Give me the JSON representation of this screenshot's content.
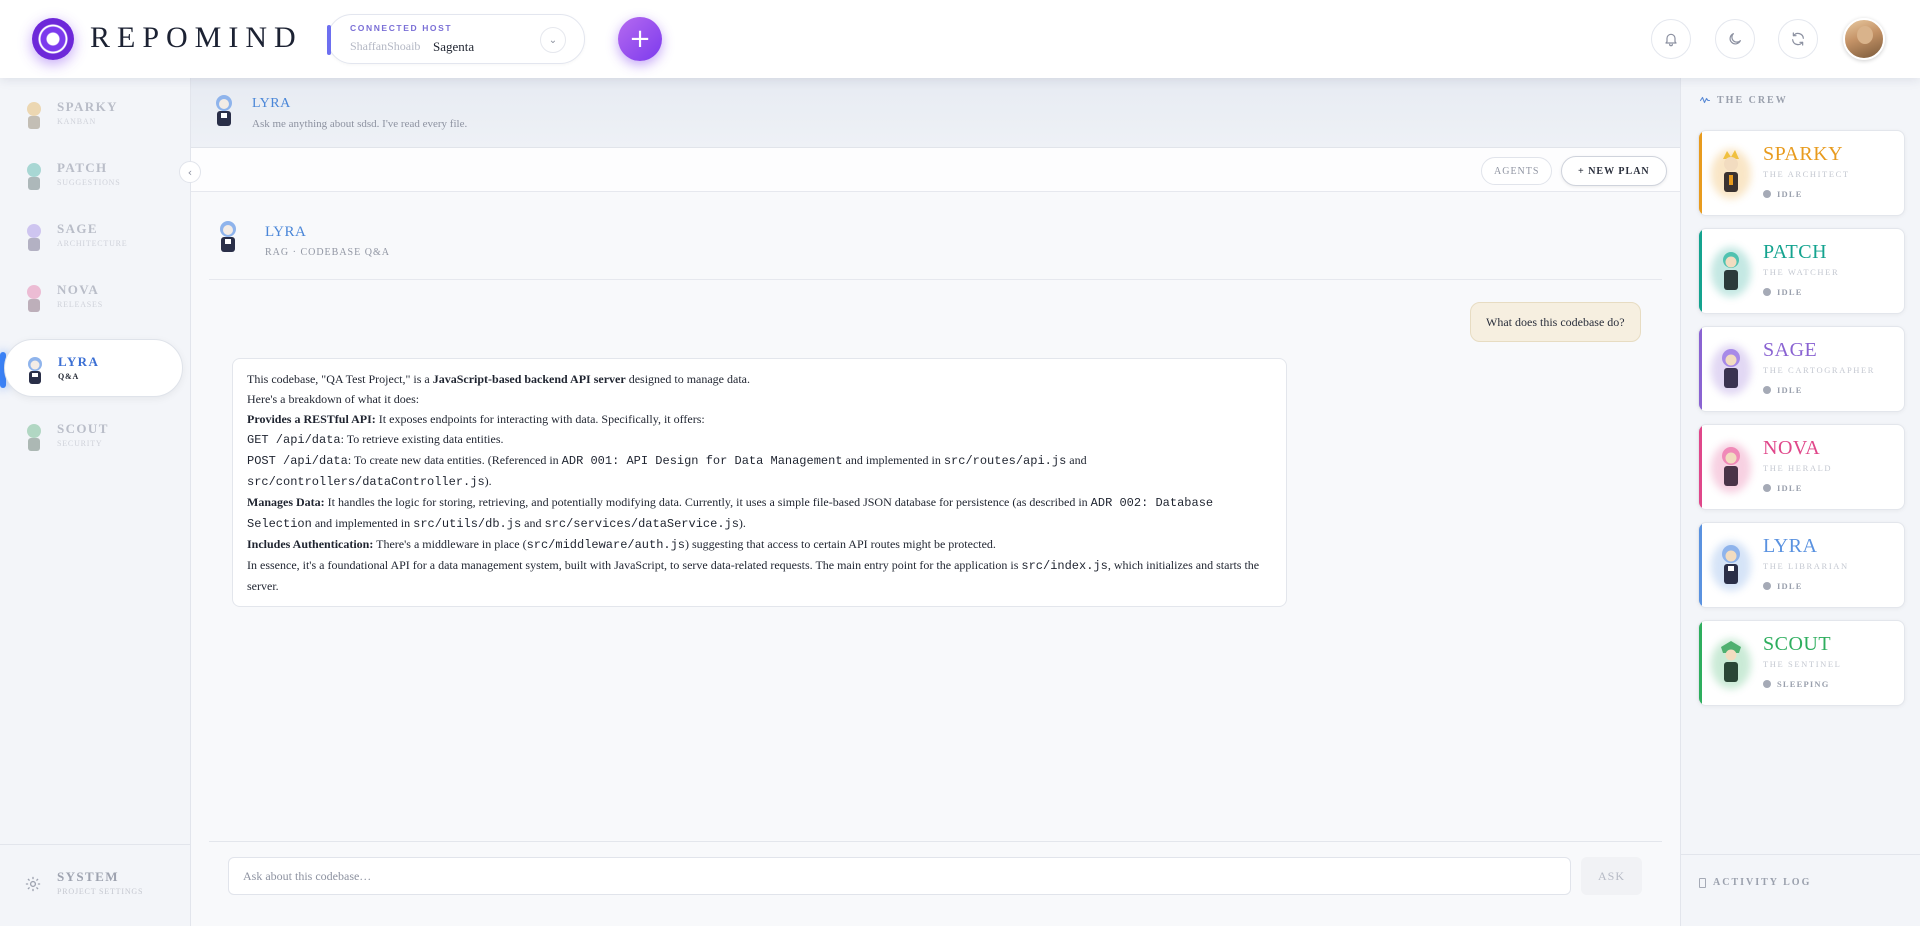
{
  "app": {
    "brand": "REPOMIND"
  },
  "header": {
    "host_label": "CONNECTED HOST",
    "host_owner": "ShaffanShoaib",
    "host_name": "Sagenta",
    "icons": [
      "bell-icon",
      "moon-icon",
      "refresh-icon"
    ]
  },
  "sidebar": {
    "items": [
      {
        "name": "SPARKY",
        "sub": "KANBAN",
        "color": "#e0a030"
      },
      {
        "name": "PATCH",
        "sub": "SUGGESTIONS",
        "color": "#20a090"
      },
      {
        "name": "SAGE",
        "sub": "ARCHITECTURE",
        "color": "#8c6ee0"
      },
      {
        "name": "NOVA",
        "sub": "RELEASES",
        "color": "#e05590"
      },
      {
        "name": "LYRA",
        "sub": "Q&A",
        "color": "#4a86d8"
      },
      {
        "name": "SCOUT",
        "sub": "SECURITY",
        "color": "#3aa060"
      }
    ],
    "system": {
      "name": "SYSTEM",
      "sub": "PROJECT SETTINGS"
    }
  },
  "main": {
    "banner": {
      "name": "LYRA",
      "desc": "Ask me anything about sdsd. I've read every file."
    },
    "toolbar": {
      "agents": "AGENTS",
      "new_plan": "+ NEW PLAN"
    },
    "chat_head": {
      "name": "LYRA",
      "sub": "RAG · CODEBASE Q&A"
    },
    "user_message": "What does this codebase do?",
    "bot": {
      "l1a": "This codebase, \"QA Test Project,\" is a ",
      "l1b": "JavaScript-based backend API server",
      "l1c": " designed to manage data.",
      "l2": "Here's a breakdown of what it does:",
      "l3a": "Provides a RESTful API:",
      "l3b": " It exposes endpoints for interacting with data. Specifically, it offers:",
      "l4a": "GET /api/data",
      "l4b": ": To retrieve existing data entities.",
      "l5a": "POST /api/data",
      "l5b": ": To create new data entities. (Referenced in ",
      "l5c": "ADR 001: API Design for Data Management",
      "l5d": " and implemented in ",
      "l5e": "src/routes/api.js",
      "l5f": " and ",
      "l5g": "src/controllers/dataController.js",
      "l5h": ").",
      "l6a": "Manages Data:",
      "l6b": " It handles the logic for storing, retrieving, and potentially modifying data. Currently, it uses a simple file-based JSON database for persistence (as described in ",
      "l6c": "ADR 002: Database Selection",
      "l6d": " and implemented in ",
      "l6e": "src/utils/db.js",
      "l6f": " and ",
      "l6g": "src/services/dataService.js",
      "l6h": ").",
      "l7a": "Includes Authentication:",
      "l7b": " There's a middleware in place (",
      "l7c": "src/middleware/auth.js",
      "l7d": ") suggesting that access to certain API routes might be protected.",
      "l8a": "In essence, it's a foundational API for a data management system, built with JavaScript, to serve data-related requests. The main entry point for the application is ",
      "l8b": "src/index.js",
      "l8c": ", which initializes and starts the server."
    },
    "input_placeholder": "Ask about this codebase…",
    "ask": "ASK"
  },
  "crew": {
    "title": "THE CREW",
    "members": [
      {
        "name": "SPARKY",
        "role": "THE ARCHITECT",
        "status": "IDLE",
        "color": "#e89b1e"
      },
      {
        "name": "PATCH",
        "role": "THE WATCHER",
        "status": "IDLE",
        "color": "#14a38f"
      },
      {
        "name": "SAGE",
        "role": "THE CARTOGRAPHER",
        "status": "IDLE",
        "color": "#8a63d2"
      },
      {
        "name": "NOVA",
        "role": "THE HERALD",
        "status": "IDLE",
        "color": "#e0478a"
      },
      {
        "name": "LYRA",
        "role": "THE LIBRARIAN",
        "status": "IDLE",
        "color": "#5a92e0"
      },
      {
        "name": "SCOUT",
        "role": "THE SENTINEL",
        "status": "SLEEPING",
        "color": "#2eae5e"
      }
    ],
    "log": "ACTIVITY LOG"
  }
}
